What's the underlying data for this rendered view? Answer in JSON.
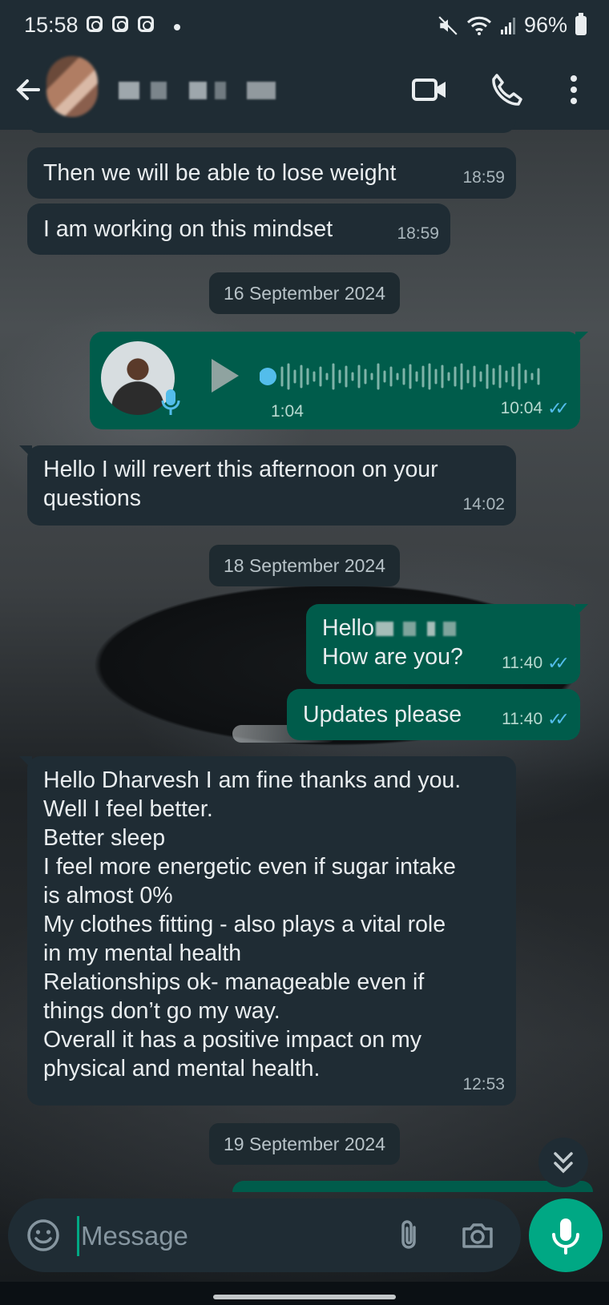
{
  "status_bar": {
    "time": "15:58",
    "battery": "96%",
    "icons": [
      "instagram-icon",
      "instagram-icon",
      "instagram-icon",
      "mute-icon",
      "wifi-icon",
      "signal-icon",
      "battery-icon"
    ]
  },
  "header": {
    "icons": [
      "back-arrow-icon",
      "video-call-icon",
      "phone-icon",
      "more-vert-icon"
    ]
  },
  "messages": {
    "m1": {
      "text": "Then we will be able to lose weight",
      "time": "18:59"
    },
    "m2": {
      "text": "I am working on this mindset",
      "time": "18:59"
    },
    "d1": "16 September 2024",
    "voice": {
      "duration": "1:04",
      "time": "10:04"
    },
    "m3": {
      "text": "Hello I will revert this afternoon on your\nquestions",
      "time": "14:02"
    },
    "d2": "18 September 2024",
    "m4": {
      "line1": "Hello",
      "line2": "How are you?",
      "time": "11:40"
    },
    "m5": {
      "text": "Updates please",
      "time": "11:40"
    },
    "m6": {
      "text": "Hello Dharvesh I am fine thanks and you.\nWell I feel better.\nBetter sleep\nI feel more energetic even if sugar intake\nis almost 0%\nMy clothes fitting - also plays a vital role\nin my mental health\nRelationships ok- manageable even if\nthings don’t go my way.\nOverall it has a positive impact on my\nphysical and mental health.",
      "time": "12:53"
    },
    "d3": "19 September 2024"
  },
  "composer": {
    "placeholder": "Message"
  },
  "colors": {
    "header_bg": "#1f2c34",
    "incoming_bubble": "#1f2c34",
    "outgoing_bubble": "#005c4b",
    "accent": "#00a884",
    "read_tick": "#53bdeb"
  }
}
